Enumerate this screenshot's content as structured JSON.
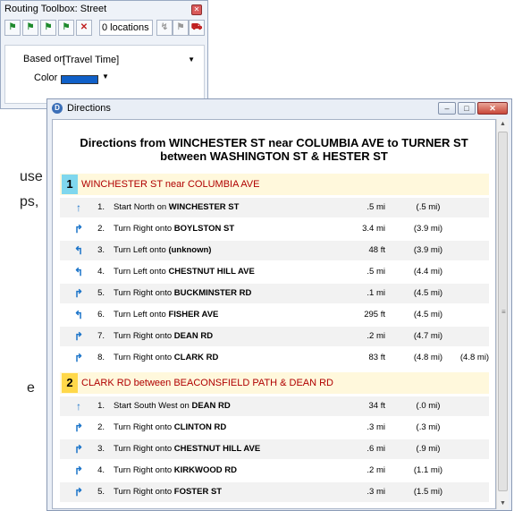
{
  "background_text": [
    "use",
    "ps,",
    "e"
  ],
  "toolbox": {
    "title": "Routing Toolbox: Street",
    "locations": "0 locations",
    "based_on_label": "Based on",
    "based_on_value": "[Travel Time]",
    "color_label": "Color",
    "color_value": "#1060c8"
  },
  "directions_window": {
    "title": "Directions",
    "heading_line1": "Directions from WINCHESTER ST near COLUMBIA AVE to TURNER ST",
    "heading_line2": "between WASHINGTON ST & HESTER ST",
    "legs": [
      {
        "number": "1",
        "title": "WINCHESTER ST near COLUMBIA AVE",
        "badge_color": "#7fd7ee",
        "steps": [
          {
            "num": "1.",
            "icon": "arrow-up-icon",
            "prefix": "Start North on",
            "street": "WINCHESTER ST",
            "dist": ".5 mi",
            "cum": "(.5 mi)",
            "total": ""
          },
          {
            "num": "2.",
            "icon": "turn-right-icon",
            "prefix": "Turn Right onto",
            "street": "BOYLSTON ST",
            "dist": "3.4 mi",
            "cum": "(3.9 mi)",
            "total": ""
          },
          {
            "num": "3.",
            "icon": "turn-left-icon",
            "prefix": "Turn Left onto",
            "street": "(unknown)",
            "dist": "48 ft",
            "cum": "(3.9 mi)",
            "total": ""
          },
          {
            "num": "4.",
            "icon": "turn-left-icon",
            "prefix": "Turn Left onto",
            "street": "CHESTNUT HILL AVE",
            "dist": ".5 mi",
            "cum": "(4.4 mi)",
            "total": ""
          },
          {
            "num": "5.",
            "icon": "turn-right-icon",
            "prefix": "Turn Right onto",
            "street": "BUCKMINSTER RD",
            "dist": ".1 mi",
            "cum": "(4.5 mi)",
            "total": ""
          },
          {
            "num": "6.",
            "icon": "turn-left-icon",
            "prefix": "Turn Left onto",
            "street": "FISHER AVE",
            "dist": "295 ft",
            "cum": "(4.5 mi)",
            "total": ""
          },
          {
            "num": "7.",
            "icon": "turn-right-icon",
            "prefix": "Turn Right onto",
            "street": "DEAN RD",
            "dist": ".2 mi",
            "cum": "(4.7 mi)",
            "total": ""
          },
          {
            "num": "8.",
            "icon": "turn-right-icon",
            "prefix": "Turn Right onto",
            "street": "CLARK RD",
            "dist": "83 ft",
            "cum": "(4.8 mi)",
            "total": "(4.8 mi)"
          }
        ]
      },
      {
        "number": "2",
        "title": "CLARK RD between BEACONSFIELD PATH & DEAN RD",
        "badge_color": "#ffd84a",
        "steps": [
          {
            "num": "1.",
            "icon": "arrow-up-icon",
            "prefix": "Start South West on",
            "street": "DEAN RD",
            "dist": "34 ft",
            "cum": "(.0 mi)",
            "total": ""
          },
          {
            "num": "2.",
            "icon": "turn-right-icon",
            "prefix": "Turn Right onto",
            "street": "CLINTON RD",
            "dist": ".3 mi",
            "cum": "(.3 mi)",
            "total": ""
          },
          {
            "num": "3.",
            "icon": "turn-right-icon",
            "prefix": "Turn Right onto",
            "street": "CHESTNUT HILL AVE",
            "dist": ".6 mi",
            "cum": "(.9 mi)",
            "total": ""
          },
          {
            "num": "4.",
            "icon": "turn-right-icon",
            "prefix": "Turn Right onto",
            "street": "KIRKWOOD RD",
            "dist": ".2 mi",
            "cum": "(1.1 mi)",
            "total": ""
          },
          {
            "num": "5.",
            "icon": "turn-right-icon",
            "prefix": "Turn Right onto",
            "street": "FOSTER ST",
            "dist": ".3 mi",
            "cum": "(1.5 mi)",
            "total": ""
          }
        ]
      }
    ]
  }
}
